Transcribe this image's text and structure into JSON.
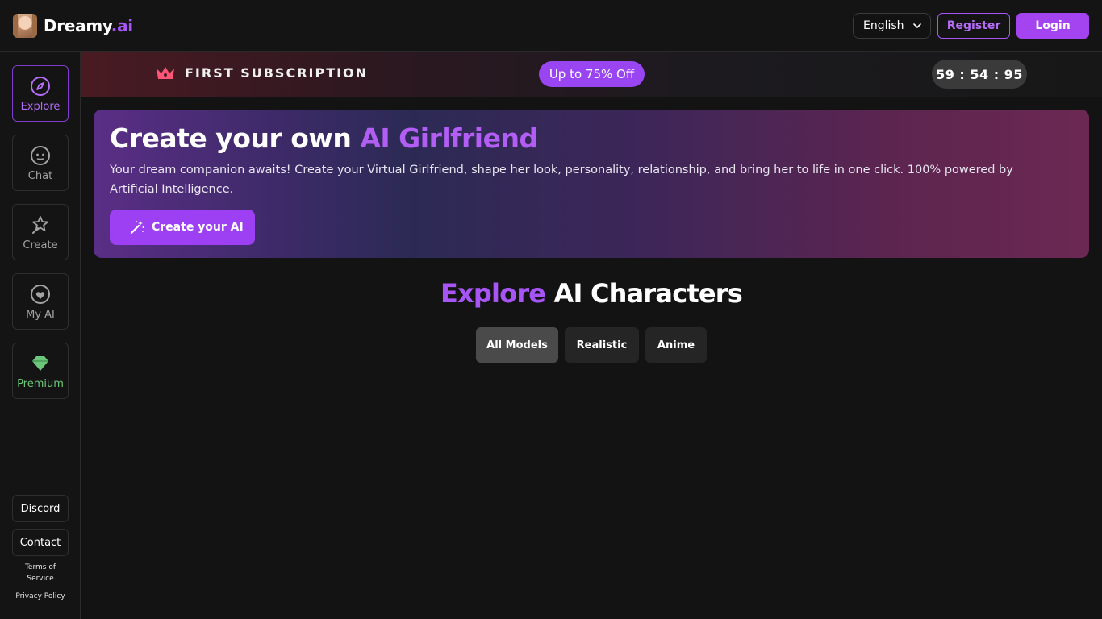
{
  "app": {
    "name": "Dreamy",
    "name_suffix": ".ai"
  },
  "header": {
    "language": "English",
    "register_label": "Register",
    "login_label": "Login"
  },
  "sidebar": {
    "items": [
      {
        "label": "Explore",
        "icon": "compass-icon",
        "active": true
      },
      {
        "label": "Chat",
        "icon": "chat-face-icon"
      },
      {
        "label": "Create",
        "icon": "magic-star-icon"
      },
      {
        "label": "My AI",
        "icon": "heart-face-icon"
      },
      {
        "label": "Premium",
        "icon": "diamond-icon",
        "color": "#6dc77a"
      }
    ],
    "links": [
      {
        "label": "Discord"
      },
      {
        "label": "Contact"
      }
    ],
    "terms_line1": "Terms of",
    "terms_line2": "Service",
    "privacy": "Privacy Policy"
  },
  "promo": {
    "title": "FIRST SUBSCRIPTION",
    "discount": "Up to 75% Off",
    "countdown": "59 : 54 : 95"
  },
  "hero": {
    "title_plain": "Create your own ",
    "title_accent": "AI Girlfriend",
    "description": "Your dream companion awaits! Create your Virtual Girlfriend, shape her look, personality, relationship, and bring her to life in one click. 100% powered by Artificial Intelligence.",
    "cta_label": "Create your AI"
  },
  "explore": {
    "title_accent": "Explore",
    "title_plain": " AI Characters",
    "filters": [
      {
        "label": "All Models",
        "active": true
      },
      {
        "label": "Realistic"
      },
      {
        "label": "Anime"
      }
    ]
  },
  "colors": {
    "accent": "#a855f7",
    "premium": "#6dc77a",
    "background": "#131313"
  }
}
